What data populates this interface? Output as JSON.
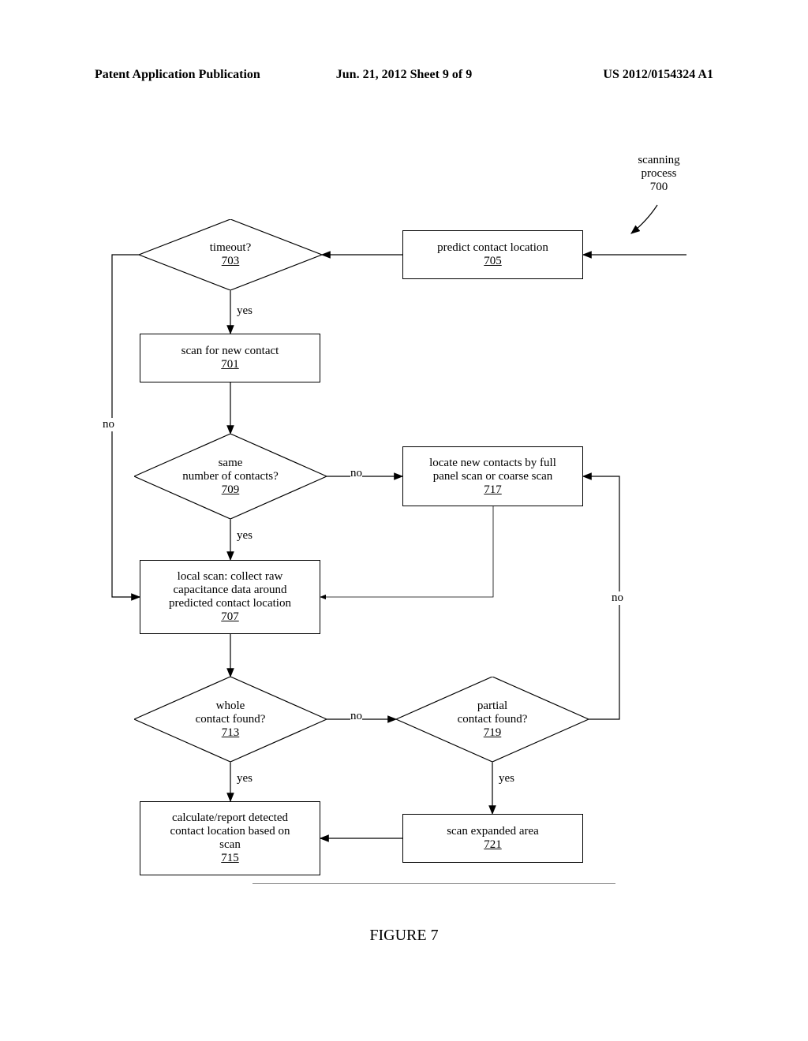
{
  "header": {
    "left": "Patent Application Publication",
    "mid": "Jun. 21, 2012  Sheet 9 of 9",
    "right": "US 2012/0154324 A1"
  },
  "entry": {
    "label1": "scanning",
    "label2": "process",
    "ref": "700"
  },
  "nodes": {
    "n705": {
      "text": "predict contact location",
      "ref": "705"
    },
    "n703": {
      "text": "timeout?",
      "ref": "703"
    },
    "n701": {
      "text": "scan for new contact",
      "ref": "701"
    },
    "n709": {
      "text1": "same",
      "text2": "number of contacts?",
      "ref": "709"
    },
    "n717": {
      "text1": "locate new contacts by full",
      "text2": "panel scan or coarse scan",
      "ref": "717"
    },
    "n707": {
      "text1": "local scan: collect raw",
      "text2": "capacitance data around",
      "text3": "predicted contact location",
      "ref": "707"
    },
    "n713": {
      "text1": "whole",
      "text2": "contact found?",
      "ref": "713"
    },
    "n719": {
      "text1": "partial",
      "text2": "contact found?",
      "ref": "719"
    },
    "n715": {
      "text1": "calculate/report detected",
      "text2": "contact location based on",
      "text3": "scan",
      "ref": "715"
    },
    "n721": {
      "text": "scan expanded area",
      "ref": "721"
    }
  },
  "labels": {
    "yes": "yes",
    "no": "no"
  },
  "figure": "FIGURE 7"
}
